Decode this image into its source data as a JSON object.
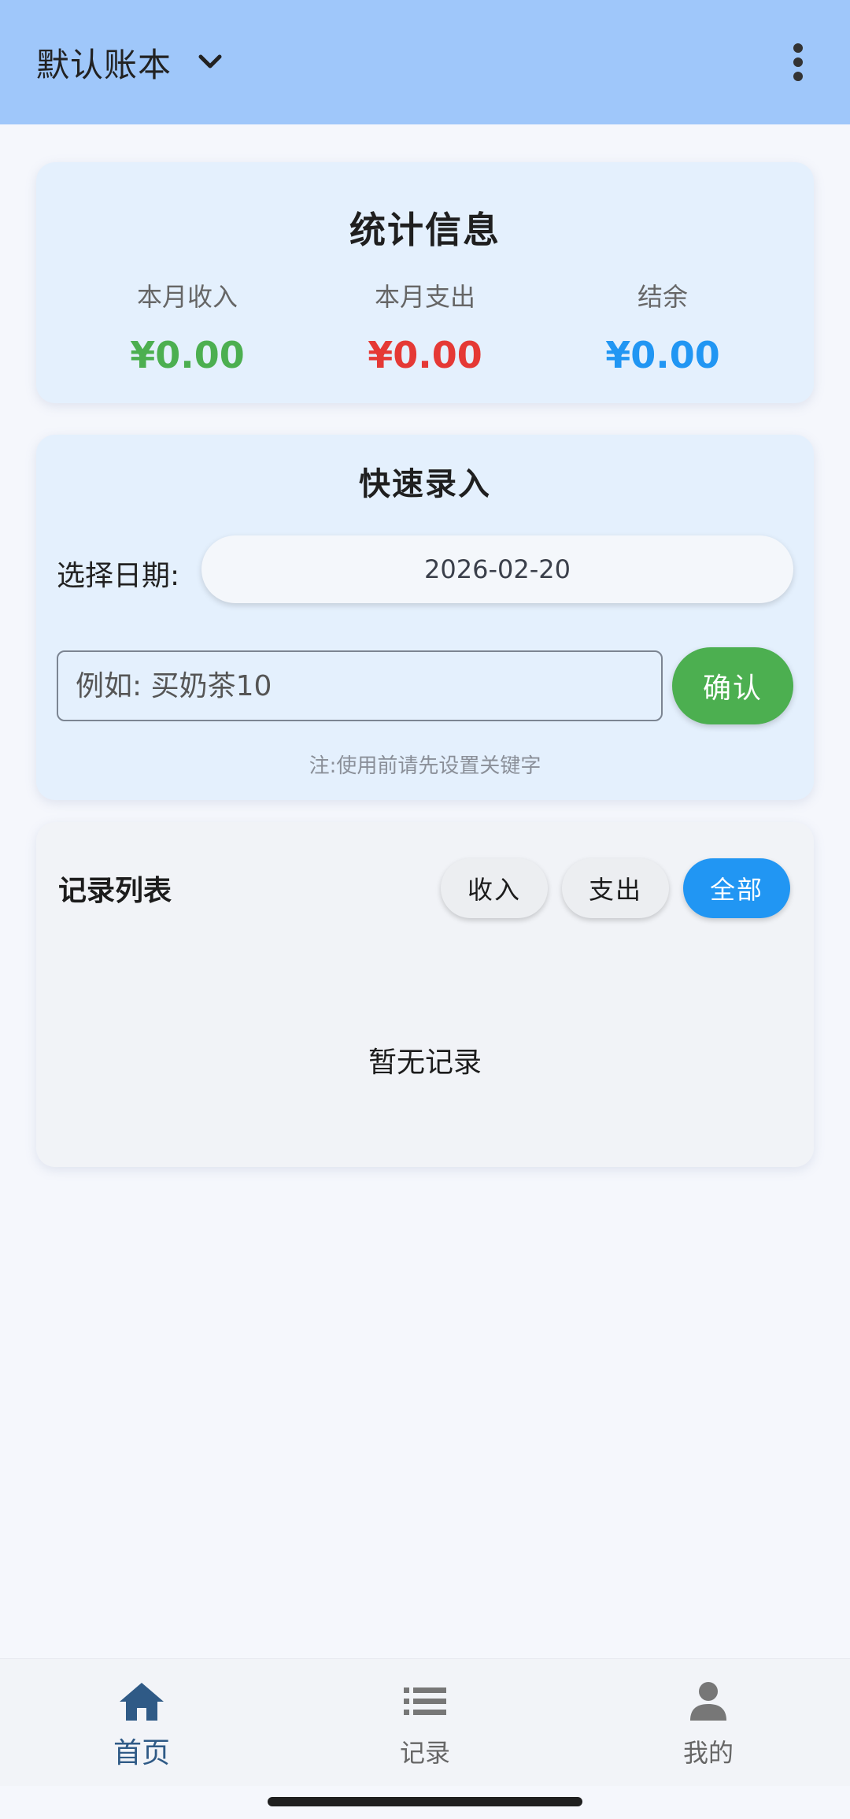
{
  "appbar": {
    "title": "默认账本",
    "bg_color": "#9fc7fa"
  },
  "stats": {
    "title": "统计信息",
    "income": {
      "label": "本月收入",
      "value": "¥0.00",
      "color": "#4caf50"
    },
    "expense": {
      "label": "本月支出",
      "value": "¥0.00",
      "color": "#e53935"
    },
    "balance": {
      "label": "结余",
      "value": "¥0.00",
      "color": "#2196f3"
    }
  },
  "quick_entry": {
    "title": "快速录入",
    "date_label": "选择日期:",
    "date_value": "2026-02-20",
    "input_placeholder": "例如: 买奶茶10",
    "confirm_label": "确认",
    "note": "注:使用前请先设置关键字"
  },
  "records": {
    "title": "记录列表",
    "filters": [
      "收入",
      "支出",
      "全部"
    ],
    "active_filter": "全部",
    "empty_text": "暂无记录"
  },
  "bottom_nav": {
    "items": [
      {
        "label": "首页",
        "icon": "home-icon",
        "active": true
      },
      {
        "label": "记录",
        "icon": "list-icon",
        "active": false
      },
      {
        "label": "我的",
        "icon": "person-icon",
        "active": false
      }
    ]
  }
}
